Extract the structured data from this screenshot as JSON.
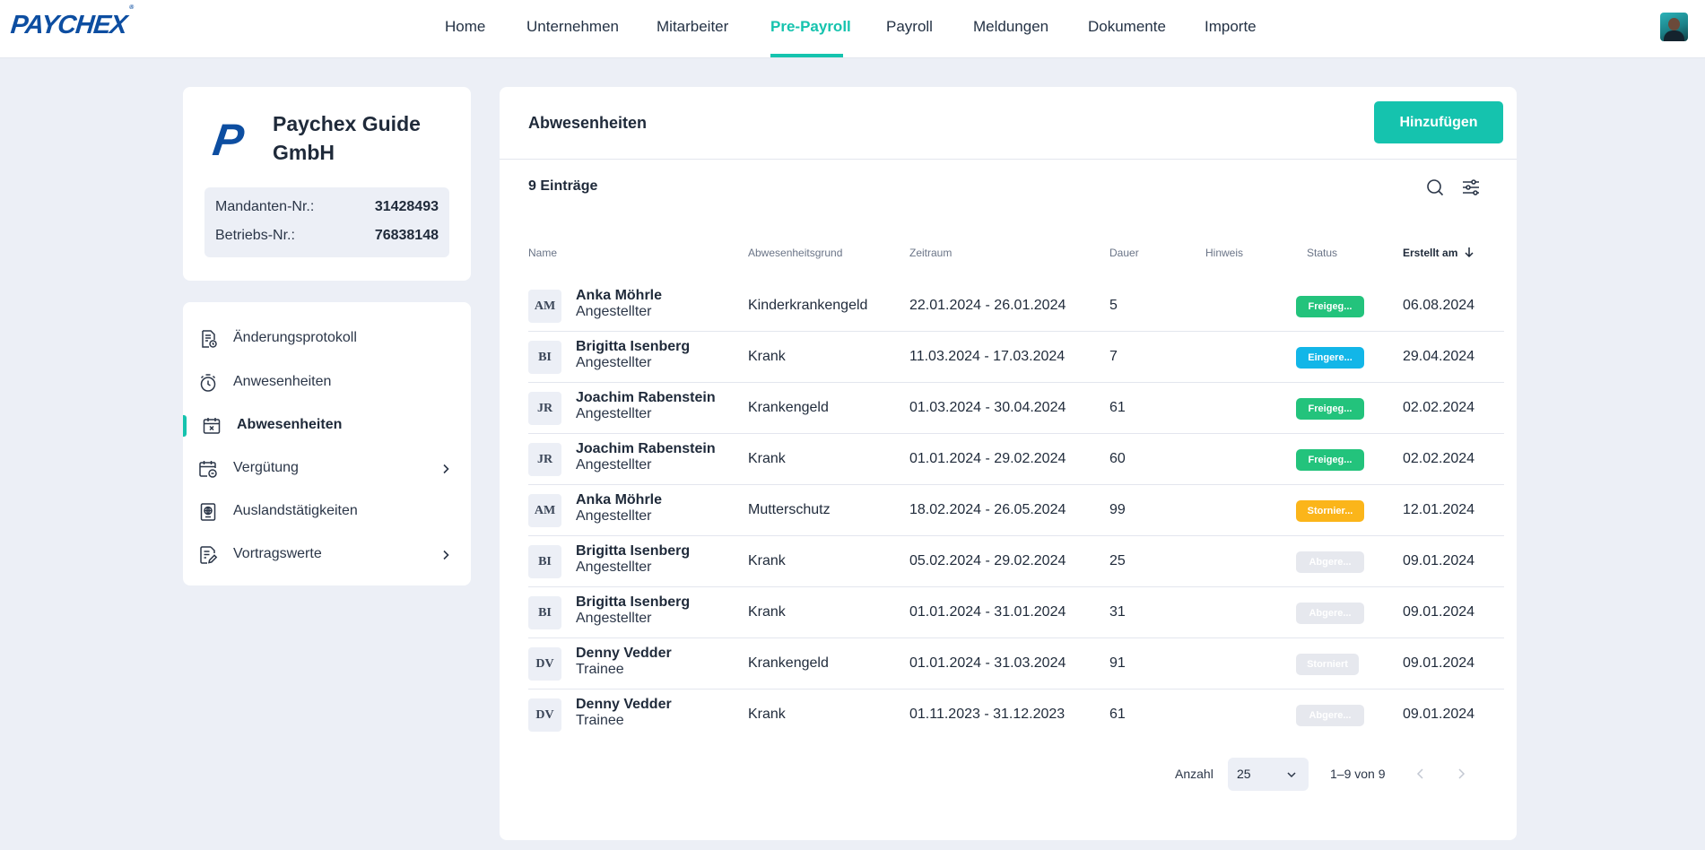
{
  "brand": {
    "logo": "PAYCHEX",
    "reg": "®"
  },
  "nav": {
    "items": [
      {
        "label": "Home"
      },
      {
        "label": "Unternehmen"
      },
      {
        "label": "Mitarbeiter"
      },
      {
        "label": "Pre-Payroll"
      },
      {
        "label": "Payroll"
      },
      {
        "label": "Meldungen"
      },
      {
        "label": "Dokumente"
      },
      {
        "label": "Importe"
      }
    ],
    "active": "Pre-Payroll"
  },
  "company": {
    "logo_letter": "P",
    "name": "Paychex Guide GmbH",
    "mandanten_label": "Mandanten-Nr.:",
    "mandanten_value": "31428493",
    "betriebs_label": "Betriebs-Nr.:",
    "betriebs_value": "76838148"
  },
  "sidebar": {
    "items": [
      {
        "label": "Änderungsprotokoll",
        "icon": "document-clock-icon"
      },
      {
        "label": "Anwesenheiten",
        "icon": "stopwatch-icon"
      },
      {
        "label": "Abwesenheiten",
        "icon": "calendar-x-icon",
        "active": true
      },
      {
        "label": "Vergütung",
        "icon": "calendar-coin-icon",
        "chevron": true
      },
      {
        "label": "Auslandstätigkeiten",
        "icon": "passport-globe-icon"
      },
      {
        "label": "Vortragswerte",
        "icon": "document-edit-icon",
        "chevron": true
      }
    ]
  },
  "main": {
    "title": "Abwesenheiten",
    "add_label": "Hinzufügen",
    "count": "9 Einträge",
    "columns": {
      "name": "Name",
      "reason": "Abwesenheitsgrund",
      "period": "Zeitraum",
      "duration": "Dauer",
      "hint": "Hinweis",
      "status": "Status",
      "created": "Erstellt am"
    },
    "rows": [
      {
        "initials": "AM",
        "name": "Anka Möhrle",
        "role": "Angestellter",
        "reason": "Kinderkrankengeld",
        "period": "22.01.2024 - 26.01.2024",
        "duration": "5",
        "hint": "",
        "status": "Freigeg...",
        "status_color": "#23c37c",
        "created": "06.08.2024"
      },
      {
        "initials": "BI",
        "name": "Brigitta Isenberg",
        "role": "Angestellter",
        "reason": "Krank",
        "period": "11.03.2024 - 17.03.2024",
        "duration": "7",
        "hint": "",
        "status": "Eingere...",
        "status_color": "#12b6e8",
        "created": "29.04.2024"
      },
      {
        "initials": "JR",
        "name": "Joachim Rabenstein",
        "role": "Angestellter",
        "reason": "Krankengeld",
        "period": "01.03.2024 - 30.04.2024",
        "duration": "61",
        "hint": "",
        "status": "Freigeg...",
        "status_color": "#23c37c",
        "created": "02.02.2024"
      },
      {
        "initials": "JR",
        "name": "Joachim Rabenstein",
        "role": "Angestellter",
        "reason": "Krank",
        "period": "01.01.2024 - 29.02.2024",
        "duration": "60",
        "hint": "",
        "status": "Freigeg...",
        "status_color": "#23c37c",
        "created": "02.02.2024"
      },
      {
        "initials": "AM",
        "name": "Anka Möhrle",
        "role": "Angestellter",
        "reason": "Mutterschutz",
        "period": "18.02.2024 - 26.05.2024",
        "duration": "99",
        "hint": "",
        "status": "Stornier...",
        "status_color": "#fbb51a",
        "created": "12.01.2024"
      },
      {
        "initials": "BI",
        "name": "Brigitta Isenberg",
        "role": "Angestellter",
        "reason": "Krank",
        "period": "05.02.2024 - 29.02.2024",
        "duration": "25",
        "hint": "",
        "status": "Abgere...",
        "status_color": "#e6e8ee",
        "created": "09.01.2024"
      },
      {
        "initials": "BI",
        "name": "Brigitta Isenberg",
        "role": "Angestellter",
        "reason": "Krank",
        "period": "01.01.2024 - 31.01.2024",
        "duration": "31",
        "hint": "",
        "status": "Abgere...",
        "status_color": "#e6e8ee",
        "created": "09.01.2024"
      },
      {
        "initials": "DV",
        "name": "Denny Vedder",
        "role": "Trainee",
        "reason": "Krankengeld",
        "period": "01.01.2024 - 31.03.2024",
        "duration": "91",
        "hint": "",
        "status": "Storniert",
        "status_color": "#e6e8ee",
        "created": "09.01.2024"
      },
      {
        "initials": "DV",
        "name": "Denny Vedder",
        "role": "Trainee",
        "reason": "Krank",
        "period": "01.11.2023 - 31.12.2023",
        "duration": "61",
        "hint": "",
        "status": "Abgere...",
        "status_color": "#e6e8ee",
        "created": "09.01.2024"
      }
    ]
  },
  "pagination": {
    "label": "Anzahl",
    "page_size": "25",
    "range": "1–9 von 9"
  },
  "colors": {
    "accent": "#15c3ae",
    "brand": "#0d4ea1"
  }
}
